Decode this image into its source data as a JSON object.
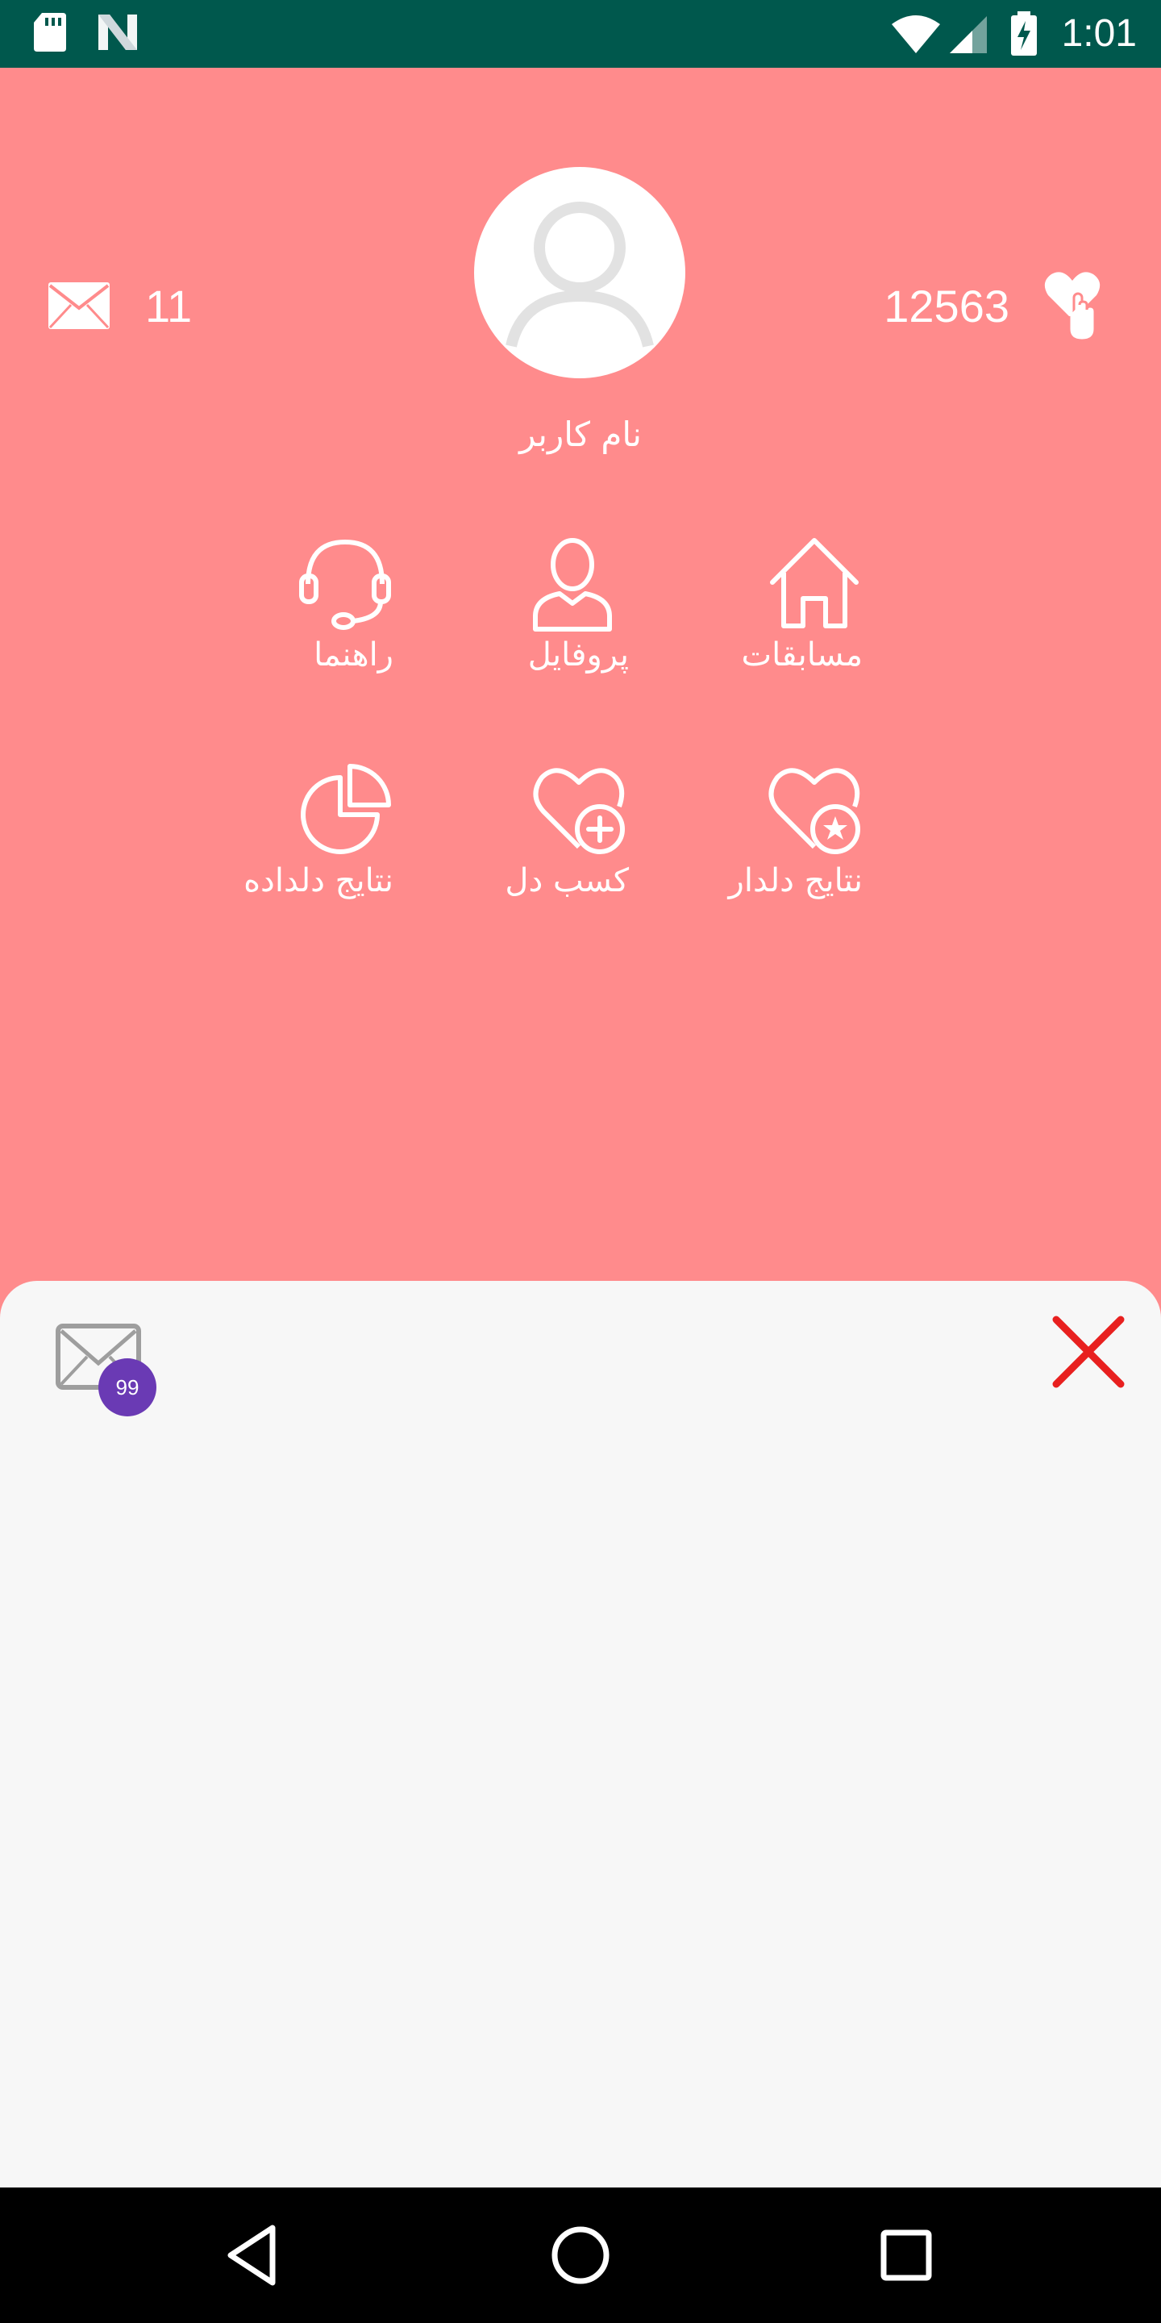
{
  "status_bar": {
    "time": "1:01",
    "icons": [
      "sd-card-icon",
      "n-logo-icon",
      "wifi-icon",
      "signal-icon",
      "battery-charging-icon"
    ],
    "background": "#00584D"
  },
  "header": {
    "background": "#FF8B8C",
    "messages_count": "11",
    "hearts_count": "12563",
    "user_name": "نام کاربر"
  },
  "menu": {
    "items": [
      {
        "label": "مسابقات",
        "icon": "home-icon"
      },
      {
        "label": "پروفایل",
        "icon": "user-icon"
      },
      {
        "label": "راهنما",
        "icon": "headset-icon"
      },
      {
        "label": "نتایج دلدار",
        "icon": "heart-star-icon"
      },
      {
        "label": "کسب دل",
        "icon": "heart-plus-icon"
      },
      {
        "label": "نتایج دلداده",
        "icon": "pie-chart-icon"
      }
    ]
  },
  "sheet": {
    "badge_count": "99",
    "badge_color": "#6A3AB4",
    "close_color": "#E8201F"
  },
  "nav_bar": {
    "buttons": [
      "back-icon",
      "home-circle-icon",
      "recents-icon"
    ]
  }
}
